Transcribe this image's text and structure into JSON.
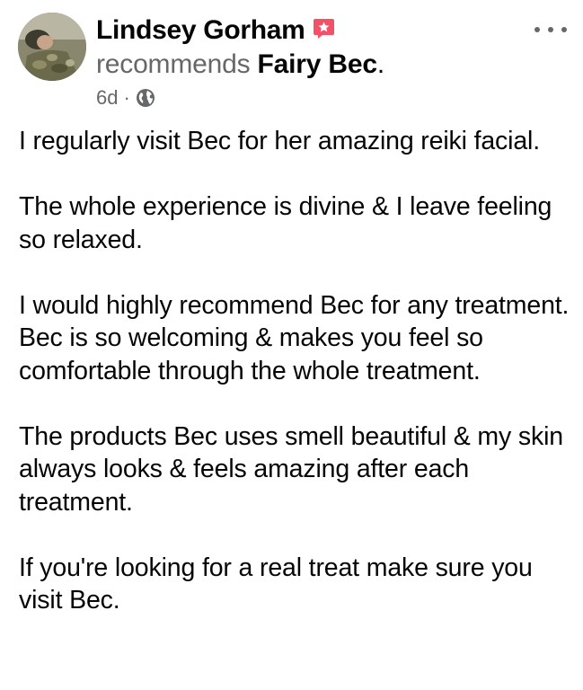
{
  "post": {
    "author": "Lindsey Gorham",
    "recommends_verb": "recommends",
    "page_name": "Fairy Bec",
    "recommends_end": ".",
    "timestamp": "6d",
    "separator": "·",
    "privacy_icon": "globe-icon",
    "badge_icon": "recommendation-star-icon",
    "more_icon": "more-options-icon",
    "badge_color": "#f25268",
    "paragraphs": [
      "I regularly visit Bec for her amazing reiki facial.",
      "The whole experience is divine  & I leave feeling so relaxed.",
      "I would highly recommend Bec for any treatment.\nBec is so welcoming & makes you feel so comfortable through the whole treatment.",
      "The products Bec uses smell beautiful & my skin always looks & feels amazing after each treatment.",
      "If you're looking for a real treat   make sure you visit Bec."
    ]
  }
}
